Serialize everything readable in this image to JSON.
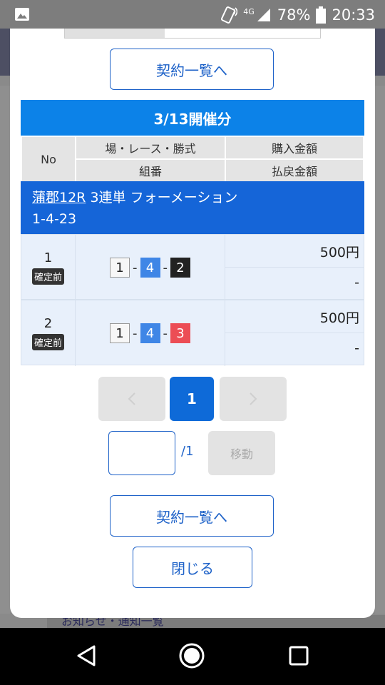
{
  "status_bar": {
    "network": "4G",
    "battery": "78%",
    "time": "20:33"
  },
  "background": {
    "bottom_link": "お知らせ・通知一覧"
  },
  "modal": {
    "contract_list_label_top": "契約一覧へ",
    "date_header": "3/13開催分",
    "table_header": {
      "no": "No",
      "venue_race_type": "場・レース・勝式",
      "purchase_amount": "購入金額",
      "combination": "組番",
      "refund_amount": "払戻金額"
    },
    "race": {
      "link": "蒲郡12R",
      "bet_type": "3連単 フォーメーション",
      "formation": "1-4-23"
    },
    "rows": [
      {
        "no": "1",
        "status": "確定前",
        "combo": [
          "1",
          "4",
          "2"
        ],
        "separator": "-",
        "amount": "500円",
        "payout": "-"
      },
      {
        "no": "2",
        "status": "確定前",
        "combo": [
          "1",
          "4",
          "3"
        ],
        "separator": "-",
        "amount": "500円",
        "payout": "-"
      }
    ],
    "pagination": {
      "current_page": "1",
      "total_pages": "/1",
      "move_label": "移動"
    },
    "contract_list_label_bottom": "契約一覧へ",
    "close_label": "閉じる"
  }
}
